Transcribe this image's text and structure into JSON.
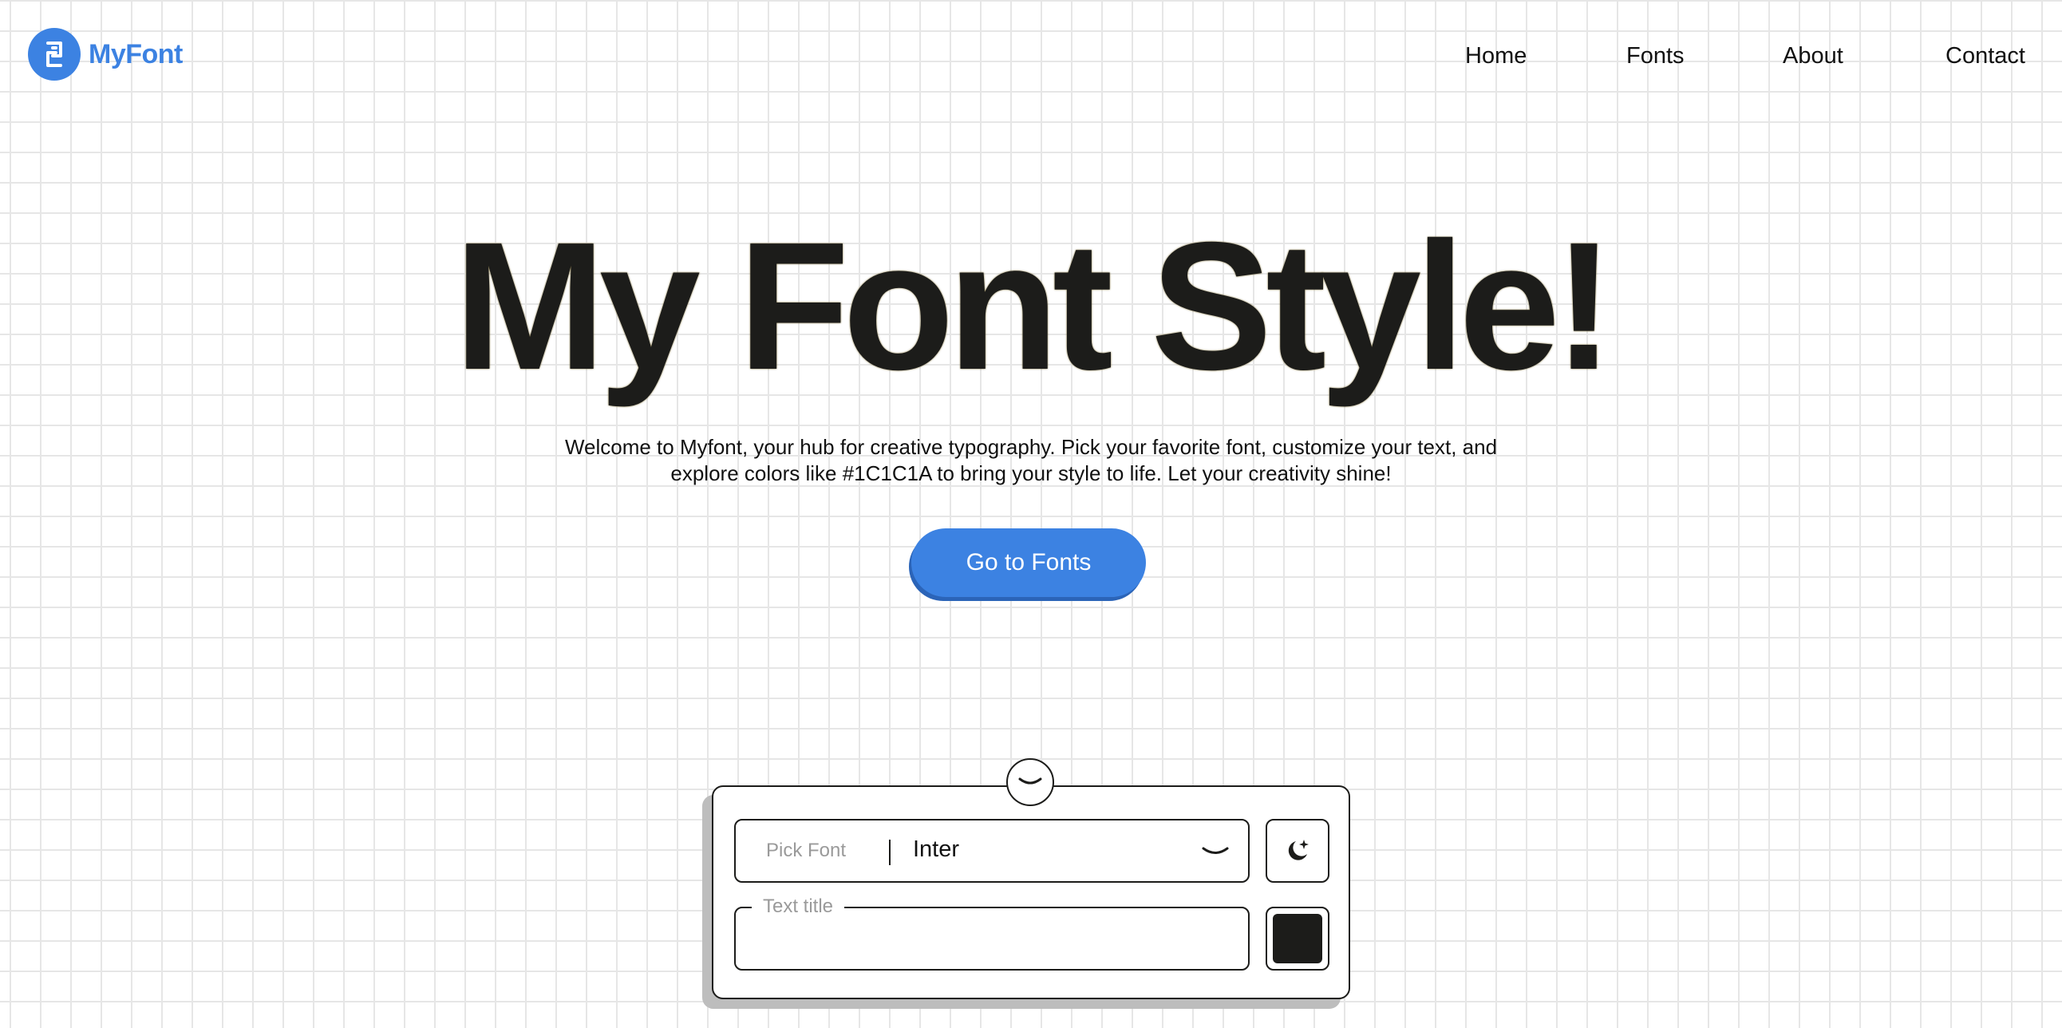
{
  "header": {
    "logo_text": "MyFont",
    "logo_icon": "myfont-logo-icon",
    "nav": [
      "Home",
      "Fonts",
      "About",
      "Contact"
    ]
  },
  "hero": {
    "title": "My Font Style!",
    "subtitle": "Welcome to Myfont, your hub for creative typography. Pick your favorite font, customize your text, and explore colors like #1C1C1A to bring your style to life. Let your creativity shine!",
    "cta_label": "Go to Fonts"
  },
  "controls": {
    "collapse_icon": "chevron-down-icon",
    "font_select": {
      "label": "Pick Font",
      "value": "Inter",
      "icon": "chevron-down-icon"
    },
    "theme_toggle_icon": "moon-sparkle-icon",
    "text_field": {
      "legend": "Text title",
      "value": ""
    },
    "color_value": "#1C1C1A"
  },
  "colors": {
    "accent": "#3C82E2",
    "text": "#1C1C1A"
  }
}
